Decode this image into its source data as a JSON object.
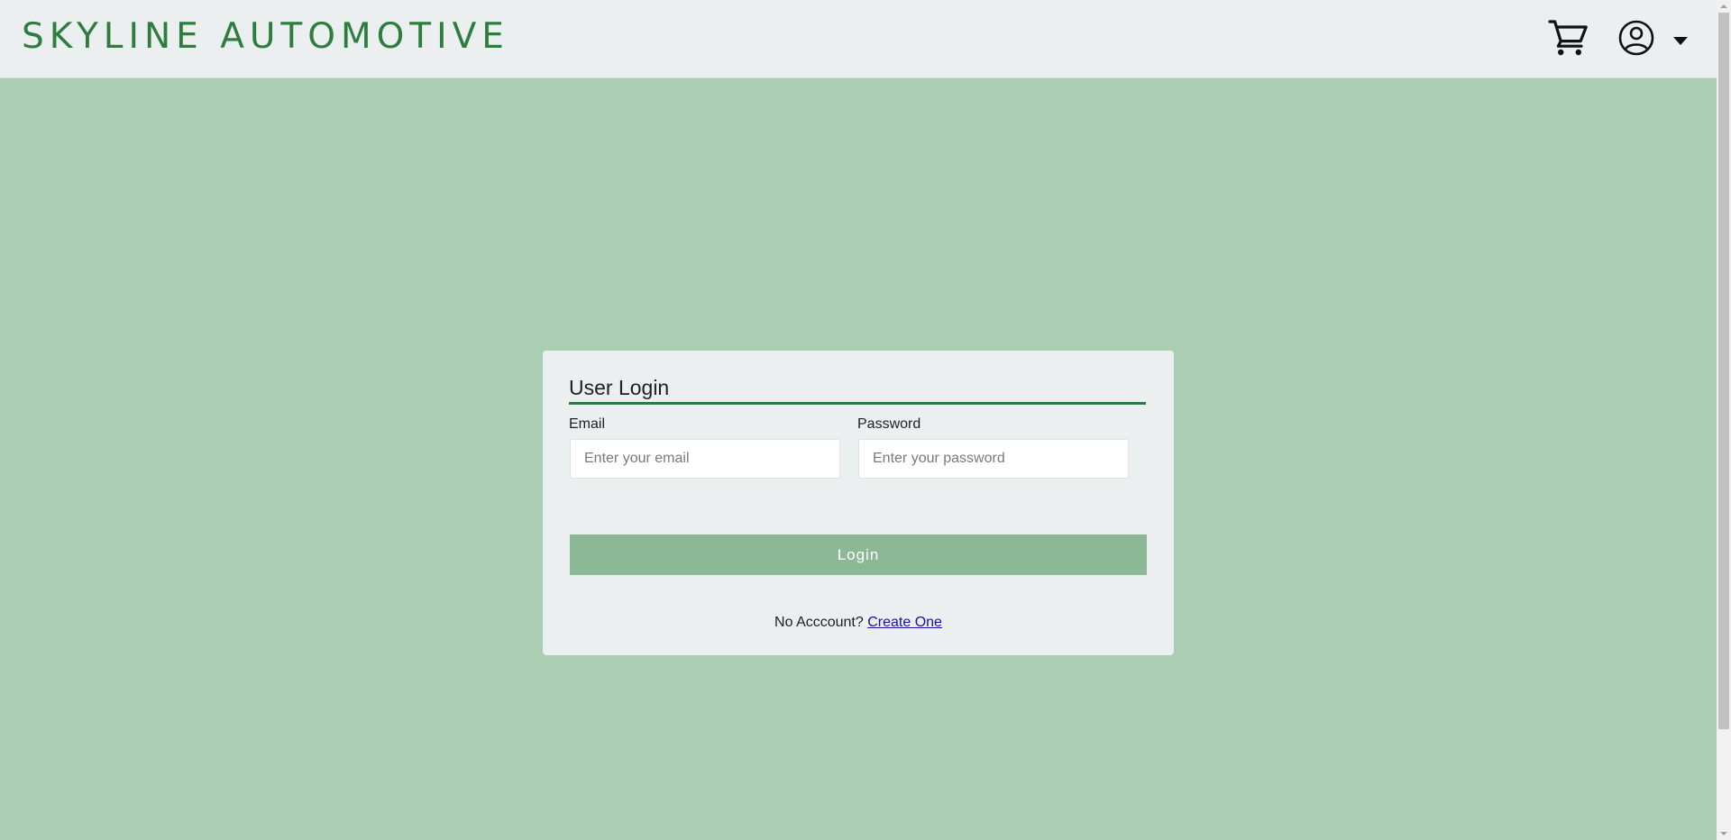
{
  "header": {
    "brand": "SKYLINE AUTOMOTIVE",
    "cart_icon": "cart-icon",
    "account_icon": "user-circle-icon",
    "account_caret_icon": "caret-down-icon"
  },
  "login": {
    "title": "User Login",
    "email_label": "Email",
    "email_placeholder": "Enter your email",
    "email_value": "",
    "password_label": "Password",
    "password_placeholder": "Enter your password",
    "password_value": "",
    "submit_label": "Login",
    "no_account_text": "No Acccount?",
    "create_link_text": "Create One"
  },
  "colors": {
    "page_background": "#abcdb2",
    "header_background": "#ebeff0",
    "brand": "#2e7d3f",
    "card_background": "#ebeff0",
    "title_underline": "#2e7d3f",
    "button_background": "#8cb896",
    "link": "#1a0dab"
  }
}
